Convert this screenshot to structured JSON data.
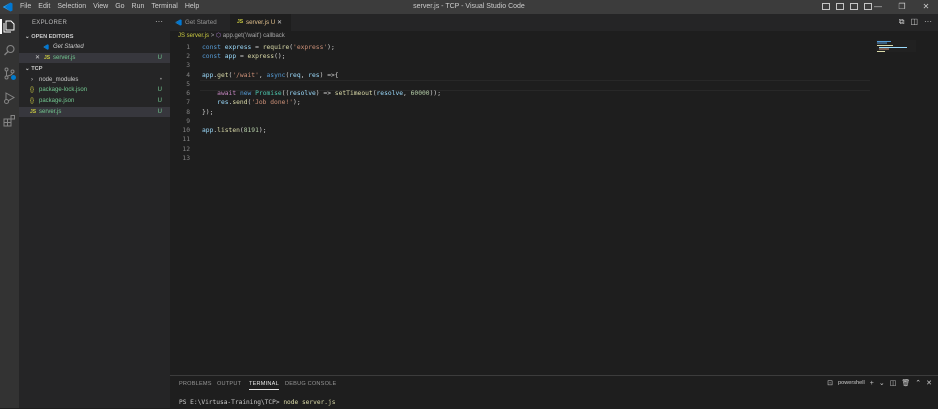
{
  "window": {
    "title": "server.js - TCP - Visual Studio Code",
    "menu": [
      "File",
      "Edit",
      "Selection",
      "View",
      "Go",
      "Run",
      "Terminal",
      "Help"
    ],
    "controls": [
      "—",
      "❐",
      "✕"
    ]
  },
  "activity_bar": [
    "explorer-icon",
    "search-icon",
    "source-control-icon",
    "run-debug-icon",
    "extensions-icon"
  ],
  "sidebar": {
    "title": "EXPLORER",
    "more": "···",
    "open_editors": {
      "heading": "OPEN EDITORS",
      "items": [
        {
          "label": "Get Started",
          "icon": "vscode-icon",
          "status": ""
        },
        {
          "label": "server.js",
          "icon": "js-icon",
          "status": "U",
          "close": "✕"
        }
      ]
    },
    "folder": {
      "heading": "TCP",
      "items": [
        {
          "label": "node_modules",
          "icon": "folder-chevron-icon",
          "status": "•"
        },
        {
          "label": "package-lock.json",
          "icon": "json-icon",
          "status": "U"
        },
        {
          "label": "package.json",
          "icon": "json-icon",
          "status": "U"
        },
        {
          "label": "server.js",
          "icon": "js-icon",
          "status": "U"
        }
      ]
    }
  },
  "tabs": [
    {
      "label": "Get Started",
      "active": false
    },
    {
      "label": "server.js U",
      "active": true,
      "close": "✕"
    }
  ],
  "breadcrumb": [
    "JS server.js",
    ">",
    "app.get('/wait') callback"
  ],
  "editor": {
    "line_numbers": [
      "1",
      "2",
      "3",
      "4",
      "5",
      "6",
      "7",
      "8",
      "9",
      "10",
      "11",
      "12",
      "13"
    ],
    "code": [
      "const express = require('express');",
      "const app = express();",
      "",
      "app.get('/wait', async(req, res) =>{",
      "",
      "    await new Promise((resolve) => setTimeout(resolve, 60000));",
      "    res.send('Job done!');",
      "});",
      "",
      "app.listen(8191);",
      "",
      "",
      ""
    ]
  },
  "panel": {
    "tabs": [
      "PROBLEMS",
      "OUTPUT",
      "TERMINAL",
      "DEBUG CONSOLE"
    ],
    "active_tab": "TERMINAL",
    "terminal_name": "powershell",
    "terminal_prompt": "PS E:\\Virtusa-Training\\TCP>",
    "terminal_command": "node server.js"
  },
  "colors": {
    "accent": "#007acc",
    "untracked": "#73c991",
    "modified_tab": "#e2c08d"
  }
}
